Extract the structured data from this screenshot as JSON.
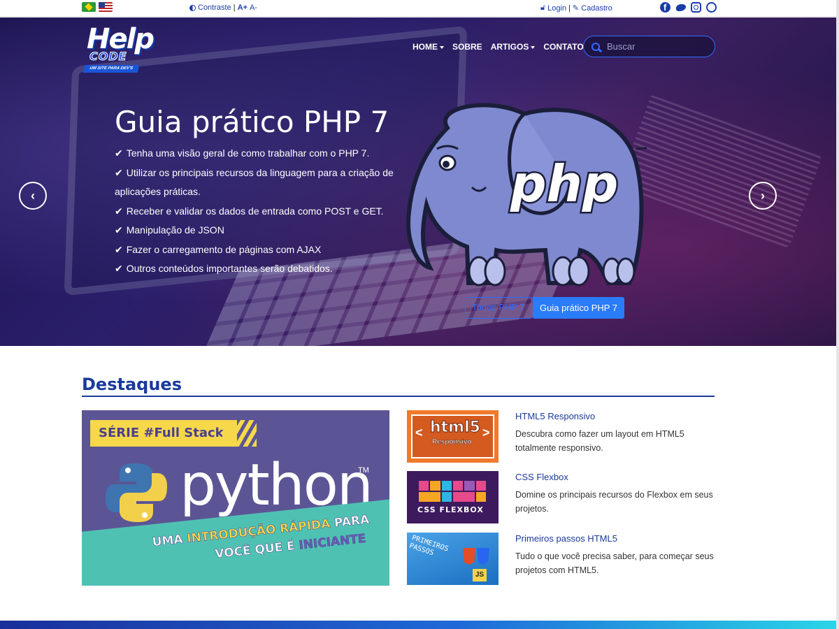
{
  "topbar": {
    "contrast_label": "Contraste",
    "sep": "|",
    "font_increase": "A+",
    "font_decrease": "A-",
    "login_label": "Login",
    "signup_label": "Cadastro",
    "social_icons": [
      "facebook-icon",
      "twitter-icon",
      "instagram-icon",
      "whatsapp-icon"
    ]
  },
  "header": {
    "logo_help": "Help",
    "logo_code": "CODE",
    "logo_tagline": "UM SITE PARA DEV'S",
    "nav": [
      {
        "label": "HOME",
        "dropdown": true
      },
      {
        "label": "SOBRE",
        "dropdown": false
      },
      {
        "label": "ARTIGOS",
        "dropdown": true
      },
      {
        "label": "CONTATO",
        "dropdown": false
      }
    ],
    "search_placeholder": "Buscar"
  },
  "slide": {
    "title": "Guia prático PHP 7",
    "bullets": [
      "Tenha uma visão geral de como trabalhar com o PHP 7.",
      "Utilizar os principais recursos da linguagem para a criação de aplicações práticas.",
      "Receber e validar os dados de entrada como POST e GET.",
      "Manipulação de JSON",
      "Fazer o carregamento de páginas com AJAX",
      "Outros conteúdos importantes serão debatidos."
    ],
    "elephant_text": "php",
    "button_secondary": "Todos PHP 7",
    "button_primary": "Guia prático PHP 7",
    "prev_label": "‹",
    "next_label": "›"
  },
  "featured": {
    "heading": "Destaques",
    "main": {
      "serie": "SÉRIE #Full Stack",
      "word": "python",
      "tm": "TM",
      "line1_a": "UMA ",
      "line1_b": "INTRODUÇÃO RÁPIDA",
      "line1_c": " PARA",
      "line2_a": "VOCÊ QUE É ",
      "line2_b": "INICIANTE"
    },
    "cards": [
      {
        "title": "HTML5 Responsivo",
        "description": "Descubra como fazer um layout em HTML5 totalmente responsivo.",
        "thumb_big": "html5",
        "thumb_small": "Responsivo"
      },
      {
        "title": "CSS Flexbox",
        "description": "Domine os principais recursos do Flexbox em seus projetos.",
        "thumb_label": "CSS FLEXBOX"
      },
      {
        "title": "Primeiros passos HTML5",
        "description": "Tudo o que você precisa saber, para começar seus projetos com HTML5.",
        "thumb_text_1": "PRIMEIROS",
        "thumb_text_2": "PASSOS",
        "thumb_js": "JS"
      }
    ]
  },
  "colors": {
    "brand_blue": "#1a3a9a",
    "accent_blue": "#2a7cf8",
    "hero_dark": "#1b1450"
  }
}
